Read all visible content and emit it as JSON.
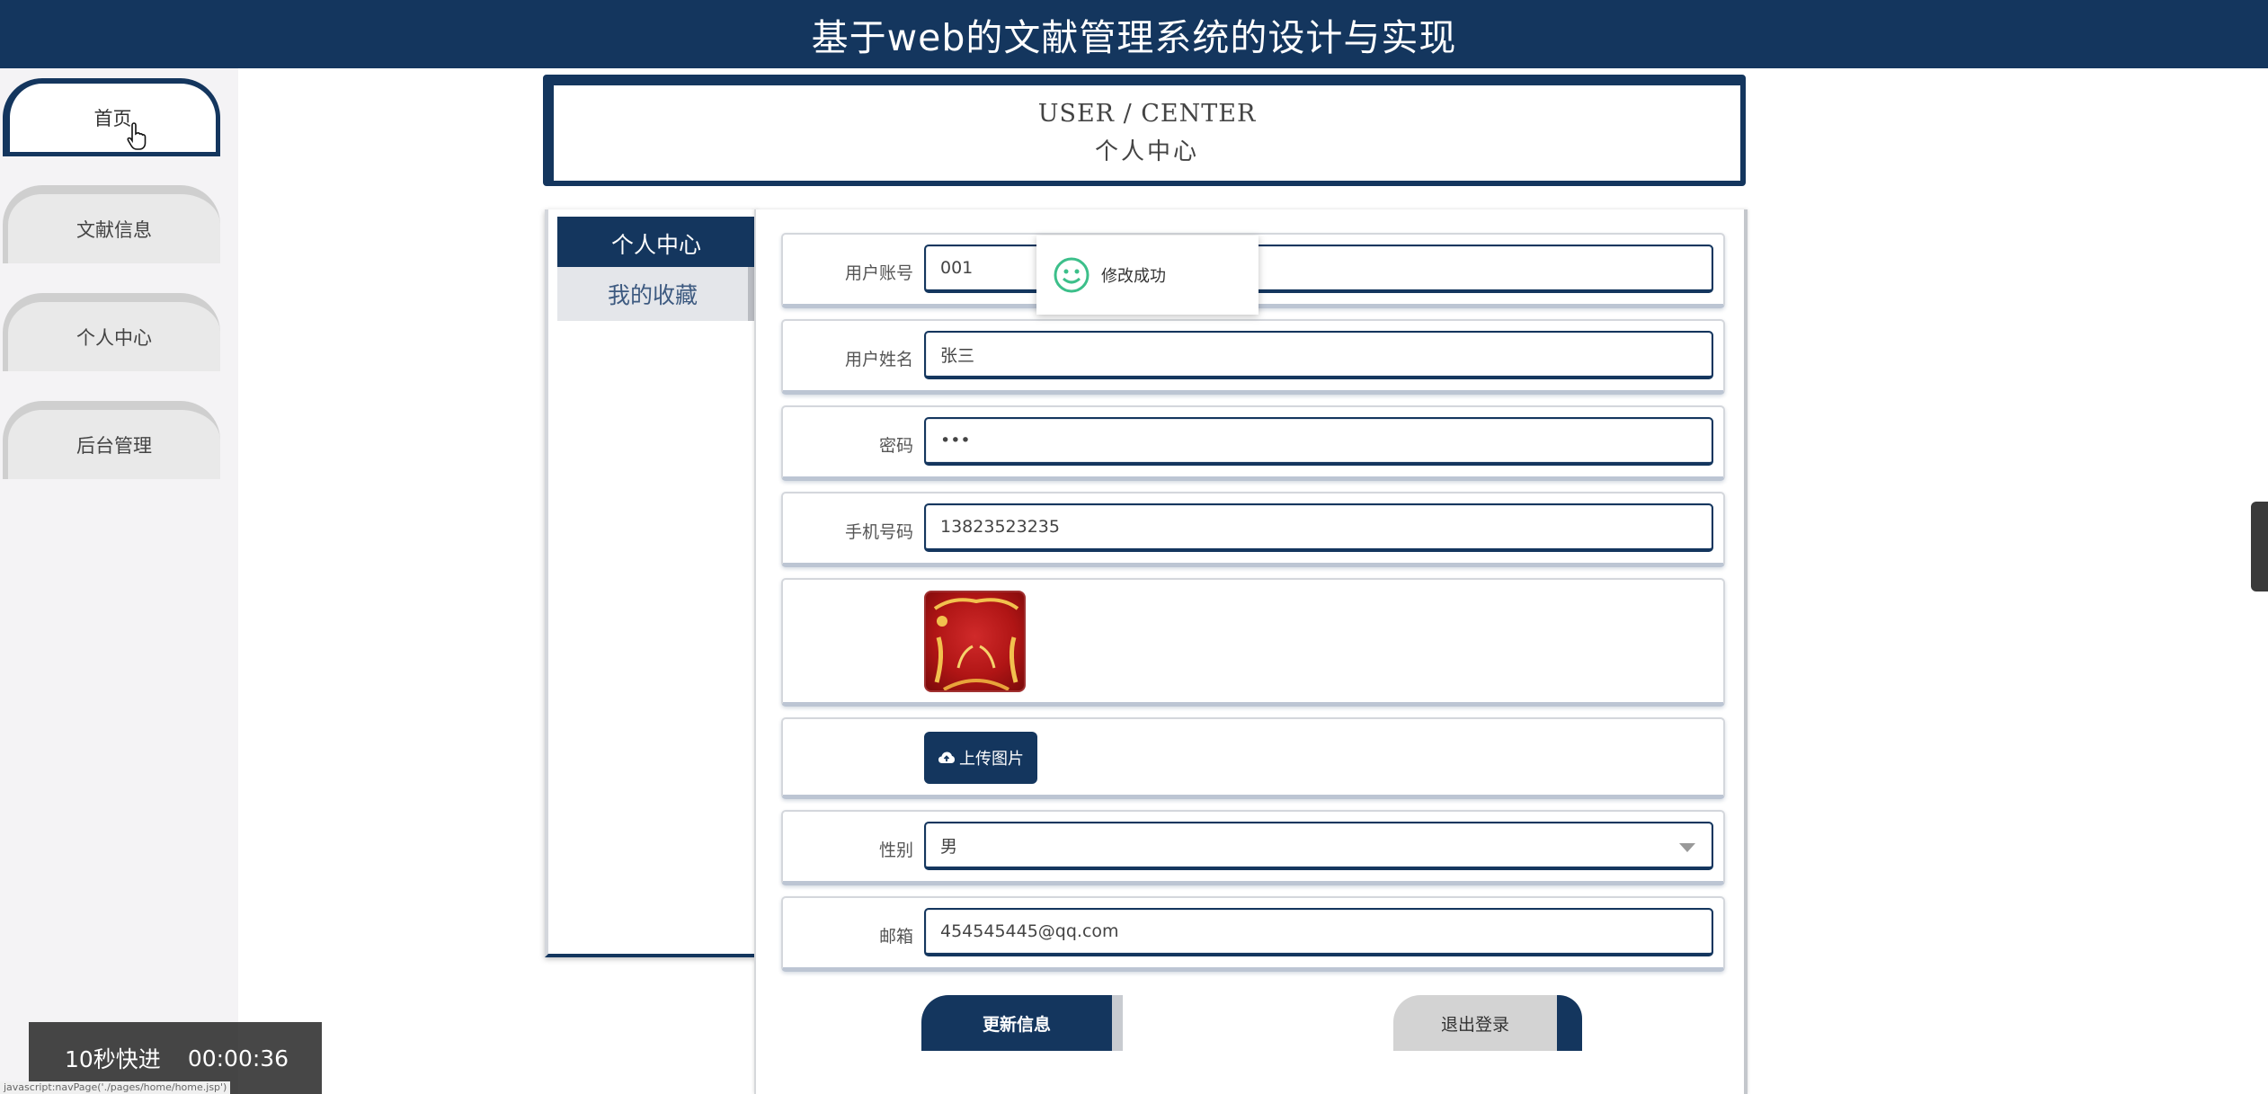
{
  "header": {
    "title": "基于web的文献管理系统的设计与实现"
  },
  "sidebar": {
    "items": [
      {
        "label": "首页"
      },
      {
        "label": "文献信息"
      },
      {
        "label": "个人中心"
      },
      {
        "label": "后台管理"
      }
    ]
  },
  "title_box": {
    "en": "USER / CENTER",
    "zh": "个人中心"
  },
  "tabs": [
    {
      "label": "个人中心"
    },
    {
      "label": "我的收藏"
    }
  ],
  "form": {
    "account": {
      "label": "用户账号",
      "value": "001"
    },
    "name": {
      "label": "用户姓名",
      "value": "张三"
    },
    "password": {
      "label": "密码",
      "value": "•••"
    },
    "phone": {
      "label": "手机号码",
      "value": "13823523235"
    },
    "upload_label": "上传图片",
    "gender": {
      "label": "性别",
      "value": "男"
    },
    "email": {
      "label": "邮箱",
      "value": "454545445@qq.com"
    },
    "update_label": "更新信息",
    "logout_label": "退出登录"
  },
  "toast": {
    "text": "修改成功"
  },
  "overlay": {
    "speed": "10秒快进",
    "time": "00:00:36"
  },
  "status_url": "javascript:navPage('./pages/home/home.jsp')",
  "colors": {
    "primary": "#14365e",
    "toast_icon": "#3cbf8a"
  }
}
